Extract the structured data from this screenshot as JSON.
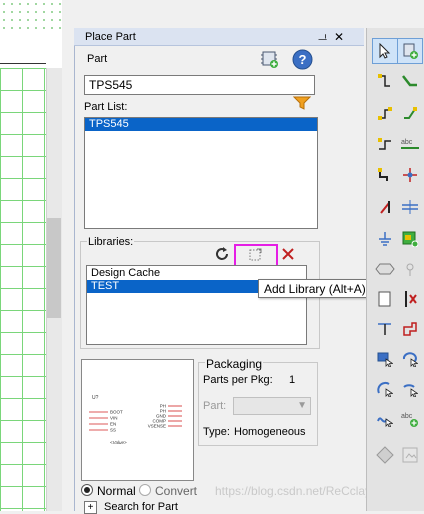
{
  "panel": {
    "title": "Place Part",
    "pin_glyph": "ᆜ",
    "close_glyph": "✕"
  },
  "part": {
    "label": "Part",
    "value": "TPS545"
  },
  "part_list": {
    "label": "Part List:",
    "items": [
      "TPS545"
    ],
    "selected_index": 0
  },
  "libraries": {
    "label": "Libraries:",
    "items": [
      "Design Cache",
      "TEST"
    ],
    "selected_index": 1
  },
  "tooltip": {
    "text": "Add Library (Alt+A)"
  },
  "packaging": {
    "title": "Packaging",
    "parts_per_pkg_label": "Parts per Pkg:",
    "parts_per_pkg_value": "1",
    "part_label": "Part:",
    "type_label": "Type:",
    "type_value": "Homogeneous"
  },
  "preview": {
    "ref": "U?",
    "left_pins": [
      "BOOT",
      "VIN",
      "EN",
      "SS"
    ],
    "right_pins": [
      "PH",
      "PH",
      "GND",
      "COMP",
      "VSENSE"
    ],
    "value_text": "<Value>"
  },
  "view": {
    "normal_label": "Normal",
    "convert_label": "Convert",
    "selected": "normal"
  },
  "search": {
    "expand_glyph": "+",
    "label": "Search for Part"
  },
  "watermark": "https://blog.csdn.net/ReCclay",
  "colors": {
    "selection": "#0a64c8",
    "highlight_box": "#e51ee5",
    "grid": "#7ad67a"
  }
}
